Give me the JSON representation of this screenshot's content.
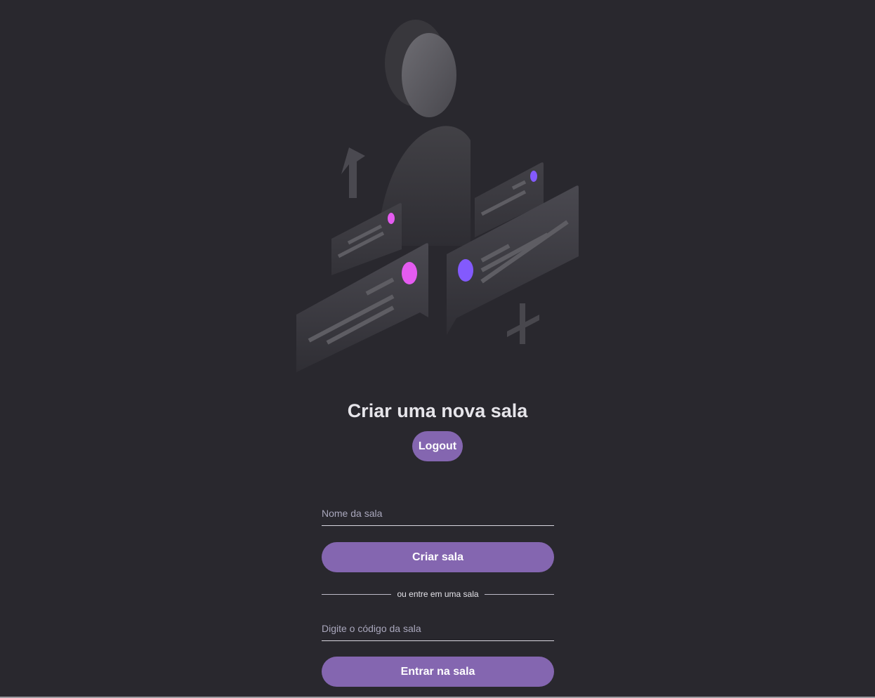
{
  "colors": {
    "background": "#29282e",
    "accent": "#8466b0",
    "text": "#e6e5ea",
    "pink_dot": "#e45bf0",
    "purple_dot": "#835afd"
  },
  "illustration": {
    "icon": "person-chat-illustration"
  },
  "header": {
    "title": "Criar uma nova sala",
    "logout_label": "Logout"
  },
  "create_room": {
    "room_name_placeholder": "Nome da sala",
    "room_name_value": "",
    "submit_label": "Criar sala"
  },
  "divider": {
    "text": "ou entre em uma sala"
  },
  "join_room": {
    "room_code_placeholder": "Digite o código da sala",
    "room_code_value": "",
    "submit_label": "Entrar na sala"
  }
}
